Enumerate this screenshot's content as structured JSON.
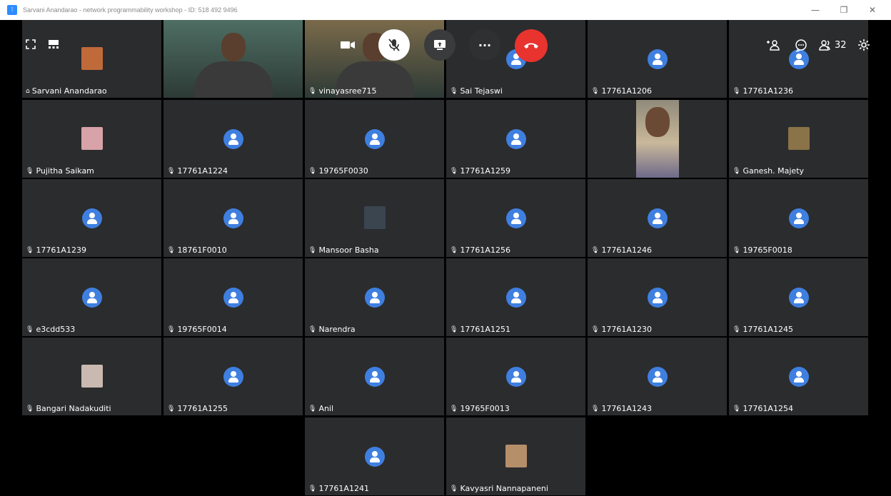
{
  "window": {
    "title": "Sarvani Anandarao - network programmability workshop - ID: 518 492 9496",
    "controls": {
      "minimize": "—",
      "restore": "❐",
      "close": "✕"
    }
  },
  "toolbar": {
    "left": [
      "fullscreen-icon",
      "gallery-view-icon"
    ],
    "center": [
      "video-camera-icon",
      "mic-muted-icon",
      "share-screen-icon",
      "more-icon",
      "end-call-icon"
    ],
    "more_label": "···",
    "participants_count": "32",
    "right": [
      "add-participant-icon",
      "chat-icon",
      "participants-icon",
      "settings-icon"
    ],
    "colors": {
      "end_call": "#e8332e",
      "mic_bg": "#ffffff",
      "share_bg": "#3a3b3d"
    }
  },
  "tiles": [
    {
      "name": "Sarvani Anandarao",
      "type": "photo",
      "host": true,
      "color": "#c06a3a"
    },
    {
      "name": "",
      "type": "video",
      "color": "#4e6e63"
    },
    {
      "name": "vinayasree715",
      "type": "video",
      "color": "#7a6a4a"
    },
    {
      "name": "Sai Tejaswi",
      "type": "avatar"
    },
    {
      "name": "17761A1206",
      "type": "avatar"
    },
    {
      "name": "17761A1236",
      "type": "avatar"
    },
    {
      "name": "Pujitha Saikam",
      "type": "photo",
      "color": "#d7a3a8"
    },
    {
      "name": "17761A1224",
      "type": "avatar"
    },
    {
      "name": "19765F0030",
      "type": "avatar"
    },
    {
      "name": "17761A1259",
      "type": "avatar"
    },
    {
      "name": "",
      "type": "video-narrow",
      "color": "#9c8f76"
    },
    {
      "name": "Ganesh. Majety",
      "type": "photo",
      "color": "#8a7348"
    },
    {
      "name": "17761A1239",
      "type": "avatar"
    },
    {
      "name": "18761F0010",
      "type": "avatar"
    },
    {
      "name": "Mansoor Basha",
      "type": "photo",
      "color": "#3b4550"
    },
    {
      "name": "17761A1256",
      "type": "avatar"
    },
    {
      "name": "17761A1246",
      "type": "avatar"
    },
    {
      "name": "19765F0018",
      "type": "avatar"
    },
    {
      "name": "e3cdd533",
      "type": "avatar"
    },
    {
      "name": "19765F0014",
      "type": "avatar"
    },
    {
      "name": "Narendra",
      "type": "avatar"
    },
    {
      "name": "17761A1251",
      "type": "avatar"
    },
    {
      "name": "17761A1230",
      "type": "avatar"
    },
    {
      "name": "17761A1245",
      "type": "avatar"
    },
    {
      "name": "Bangari Nadakuditi",
      "type": "photo",
      "color": "#c9b9b0"
    },
    {
      "name": "17761A1255",
      "type": "avatar"
    },
    {
      "name": "Anil",
      "type": "avatar"
    },
    {
      "name": "19765F0013",
      "type": "avatar"
    },
    {
      "name": "17761A1243",
      "type": "avatar"
    },
    {
      "name": "17761A1254",
      "type": "avatar"
    },
    {
      "name": "17761A1241",
      "type": "avatar"
    },
    {
      "name": "Kavyasri Nannapaneni",
      "type": "photo",
      "color": "#b58e6a"
    }
  ],
  "icons": {
    "muted_mic": "🎙︎",
    "host": "⌂"
  }
}
